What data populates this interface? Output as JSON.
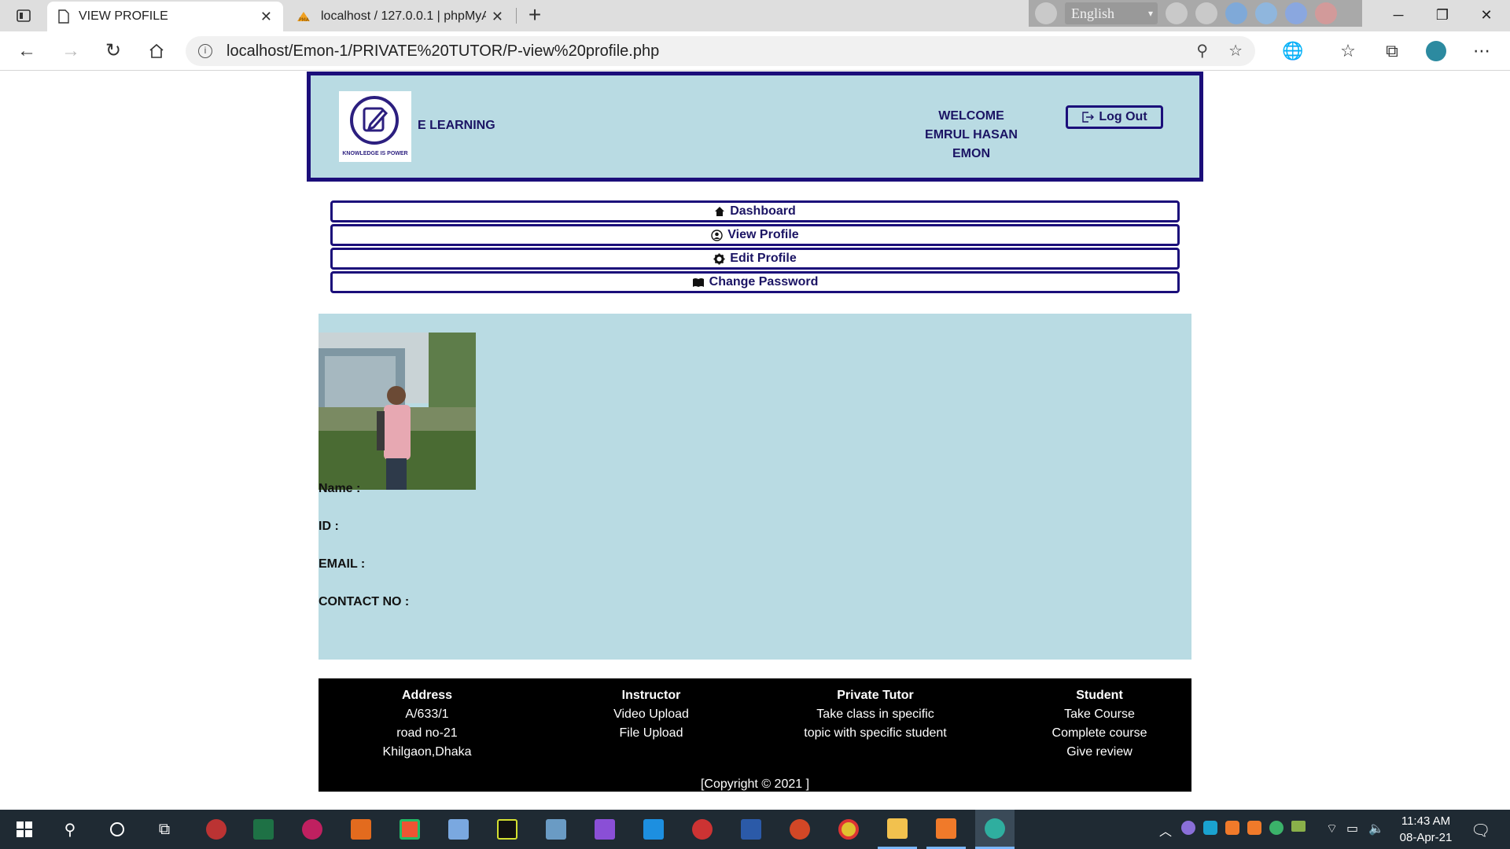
{
  "browser": {
    "tabs": [
      {
        "title": "VIEW PROFILE",
        "active": true,
        "icon": "page-icon"
      },
      {
        "title": "localhost / 127.0.0.1 | phpMyAdmin",
        "active": false,
        "icon": "phpmyadmin-icon"
      }
    ],
    "url": "localhost/Emon-1/PRIVATE%20TUTOR/P-view%20profile.php",
    "language_extension": "English"
  },
  "header": {
    "logo_tagline": "KNOWLEDGE IS POWER",
    "brand": "E LEARNING",
    "welcome_line1": "WELCOME",
    "welcome_line2": "EMRUL HASAN",
    "welcome_line3": "EMON",
    "logout_label": "Log Out"
  },
  "menu": [
    {
      "label": "Dashboard",
      "icon": "home-icon"
    },
    {
      "label": "View Profile",
      "icon": "user-circle-icon"
    },
    {
      "label": "Edit Profile",
      "icon": "gear-icon"
    },
    {
      "label": "Change Password",
      "icon": "book-icon"
    }
  ],
  "profile": {
    "name_label": "Name :",
    "id_label": "ID :",
    "email_label": "EMAIL :",
    "contact_label": "CONTACT NO :"
  },
  "footer": {
    "columns": [
      {
        "heading": "Address",
        "lines": [
          "A/633/1",
          "road no-21",
          "Khilgaon,Dhaka"
        ]
      },
      {
        "heading": "Instructor",
        "lines": [
          "Video Upload",
          "File Upload",
          ""
        ]
      },
      {
        "heading": "Private Tutor",
        "lines": [
          "Take class in specific",
          "topic with specific student",
          ""
        ]
      },
      {
        "heading": "Student",
        "lines": [
          "Take Course",
          "Complete course",
          "Give review"
        ]
      }
    ],
    "copyright": "[Copyright © 2021 ]"
  },
  "taskbar": {
    "time": "11:43 AM",
    "date": "08-Apr-21"
  },
  "colors": {
    "header_bg": "#b9dbe3",
    "navy": "#1b0e7a",
    "footer_bg": "#000000"
  }
}
